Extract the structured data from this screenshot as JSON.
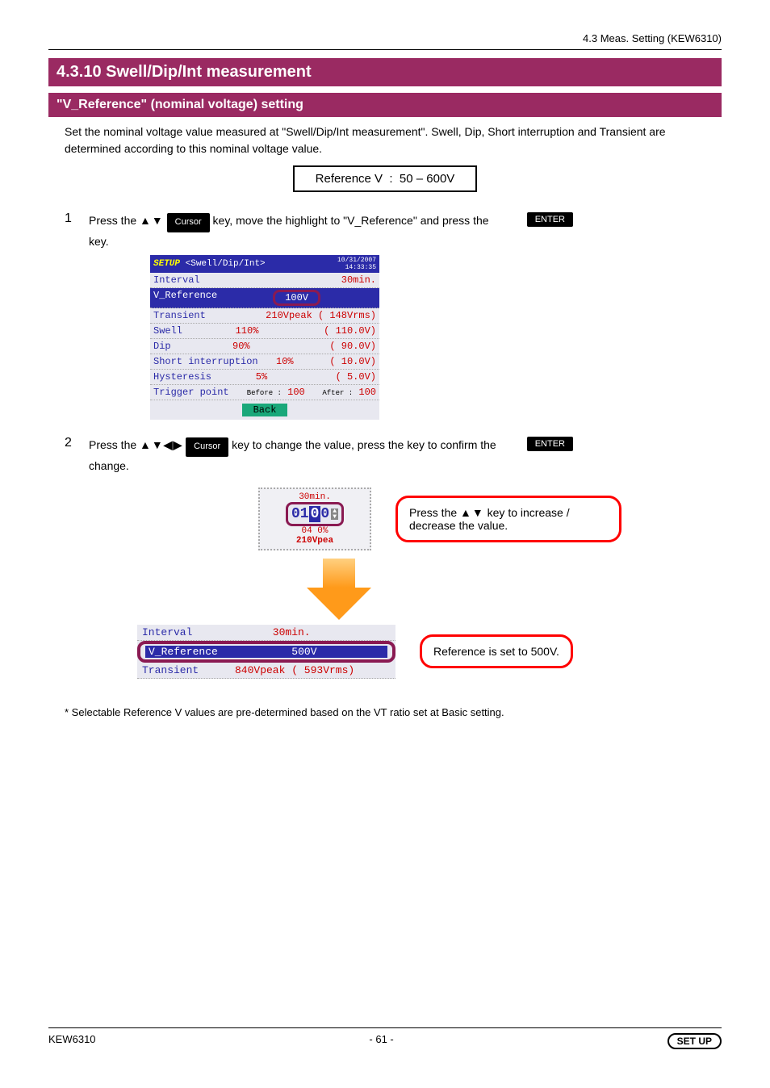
{
  "header_right": "4.3 Meas. Setting (KEW6310)",
  "section_title": "4.3.10 Swell/Dip/Int measurement",
  "subsection_title": "\"V_Reference\" (nominal voltage) setting",
  "intro": "Set the nominal voltage value measured at \"Swell/Dip/Int measurement\". Swell, Dip, Short interruption and Transient are determined according to this nominal voltage value.",
  "range_label": "Reference V",
  "range_value": "50 – 600V",
  "steps": {
    "s1": {
      "num": "1",
      "pre": "Press the ",
      "arrows": "▲▼",
      "cursor": " Cursor",
      "post": " key, move the highlight to \"V_Reference\" and press the ",
      "enter": "ENTER",
      "tail": " key."
    },
    "s2": {
      "num": "2",
      "pre": "Press the ",
      "arrows": "▲▼◀▶",
      "cursor": " Cursor",
      "post": " key to change the value, press the ",
      "enter": "ENTER",
      "tail": " key to confirm the change."
    }
  },
  "dev1": {
    "title_setup": "SETUP",
    "title_rest": "<Swell/Dip/Int>",
    "date": "10/31/2007",
    "time": "14:33:35",
    "rows": {
      "interval": {
        "lbl": "Interval",
        "val": "30min."
      },
      "vref": {
        "lbl": "V_Reference",
        "val": "100V"
      },
      "transient": {
        "lbl": "Transient",
        "val": "210Vpeak ( 148Vrms)"
      },
      "swell": {
        "lbl": "Swell",
        "pct": "110%",
        "paren": "( 110.0V)"
      },
      "dip": {
        "lbl": "Dip",
        "pct": "90%",
        "paren": "(  90.0V)"
      },
      "shortint": {
        "lbl": "Short interruption",
        "pct": "10%",
        "paren": "(  10.0V)"
      },
      "hyst": {
        "lbl": "Hysteresis",
        "pct": "5%",
        "paren": "(   5.0V)"
      },
      "trigger": {
        "lbl": "Trigger point",
        "before": "Before :",
        "bval": "100",
        "after": "After :",
        "aval": "100"
      }
    },
    "back": "Back"
  },
  "editor": {
    "top_dots": "30min.",
    "digits_left": "01",
    "digit_cur": "0",
    "digits_right": "0",
    "sub1": "04 0%",
    "sub2": "210Vpea"
  },
  "callout1_pre": "Press the ",
  "callout1_arrows": "▲▼",
  "callout1_post": " key to increase / decrease the value.",
  "dev2": {
    "interval": {
      "lbl": "Interval",
      "val": "30min."
    },
    "vref": {
      "lbl": "V_Reference",
      "val": "500V"
    },
    "transient": {
      "lbl": "Transient",
      "val": "840Vpeak ( 593Vrms)"
    }
  },
  "callout2": "Reference is set to 500V.",
  "note": "* Selectable Reference V values are pre-determined based on the VT ratio set at Basic setting.",
  "footer_left": "KEW6310",
  "footer_page": "- 61 -",
  "footer_setup": "SET UP"
}
